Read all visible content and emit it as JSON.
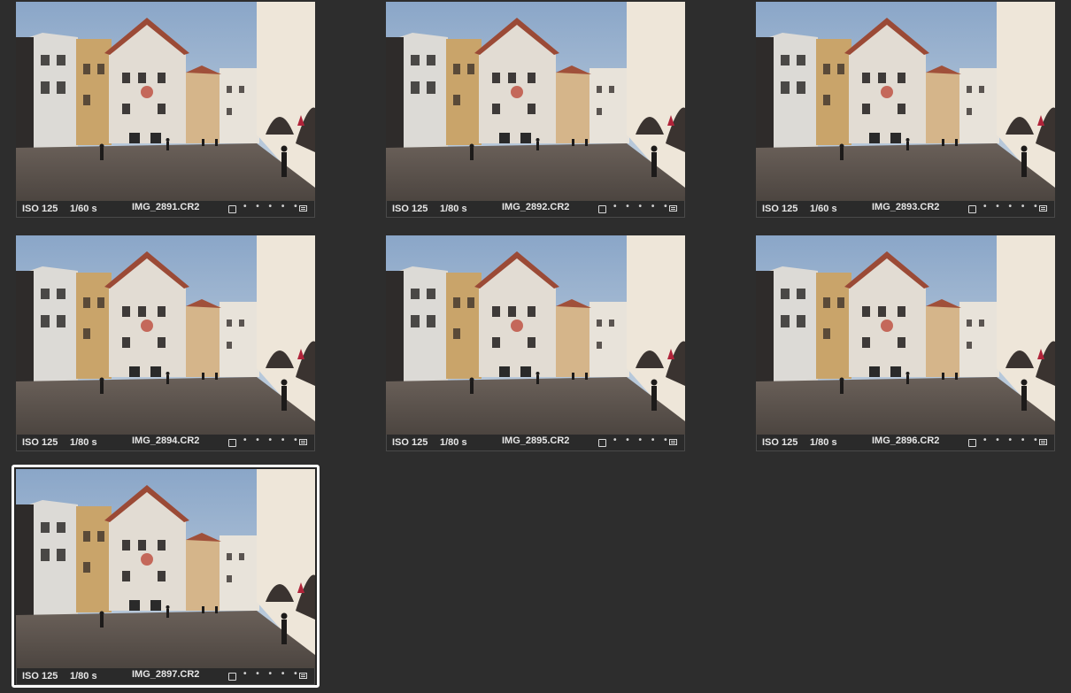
{
  "browser": {
    "items": [
      {
        "iso": "ISO 125",
        "shutter": "1/60 s",
        "filename": "IMG_2891.CR2",
        "rating": "• • • • •",
        "selected": false
      },
      {
        "iso": "ISO 125",
        "shutter": "1/80 s",
        "filename": "IMG_2892.CR2",
        "rating": "• • • • •",
        "selected": false
      },
      {
        "iso": "ISO 125",
        "shutter": "1/60 s",
        "filename": "IMG_2893.CR2",
        "rating": "• • • • •",
        "selected": false
      },
      {
        "iso": "ISO 125",
        "shutter": "1/80 s",
        "filename": "IMG_2894.CR2",
        "rating": "• • • • •",
        "selected": false
      },
      {
        "iso": "ISO 125",
        "shutter": "1/80 s",
        "filename": "IMG_2895.CR2",
        "rating": "• • • • •",
        "selected": false
      },
      {
        "iso": "ISO 125",
        "shutter": "1/80 s",
        "filename": "IMG_2896.CR2",
        "rating": "• • • • •",
        "selected": false
      },
      {
        "iso": "ISO 125",
        "shutter": "1/80 s",
        "filename": "IMG_2897.CR2",
        "rating": "• • • • •",
        "selected": true
      }
    ]
  },
  "colors": {
    "background": "#2d2d2d",
    "selection_border": "#ffffff",
    "sky": "#9fb7d2",
    "ground": "#5b534d"
  },
  "icons": {
    "flag": "flag-checkbox-icon",
    "menu": "metadata-menu-icon"
  }
}
